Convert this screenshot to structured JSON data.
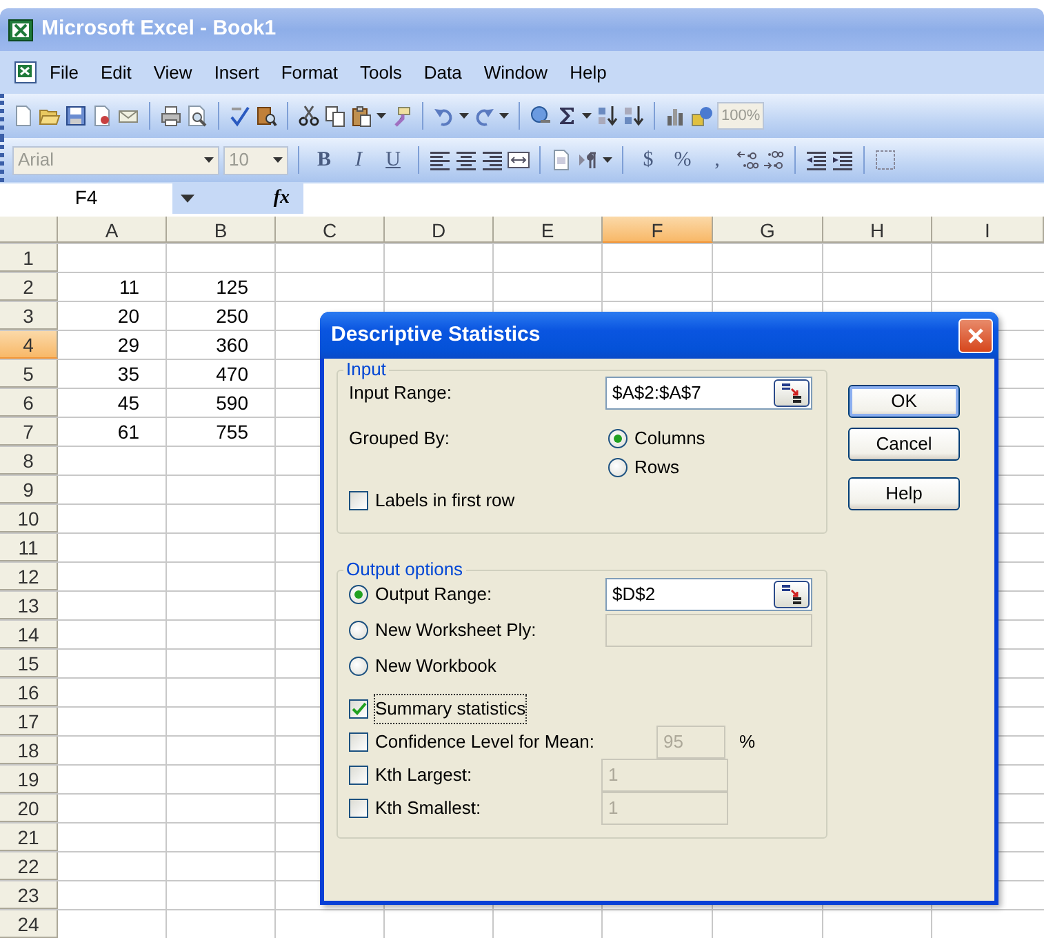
{
  "window": {
    "title": "Microsoft Excel - Book1"
  },
  "menu": [
    {
      "label": "File"
    },
    {
      "label": "Edit"
    },
    {
      "label": "View"
    },
    {
      "label": "Insert"
    },
    {
      "label": "Format"
    },
    {
      "label": "Tools"
    },
    {
      "label": "Data"
    },
    {
      "label": "Window"
    },
    {
      "label": "Help"
    }
  ],
  "standard_toolbar": {
    "zoom": "100%"
  },
  "formatting_toolbar": {
    "font": "Arial",
    "size": "10",
    "style_buttons": [
      "B",
      "I",
      "U"
    ],
    "number_buttons": [
      "$",
      "%",
      ","
    ]
  },
  "formula_bar": {
    "name_box": "F4",
    "function_label": "fx"
  },
  "sheet": {
    "columns": [
      {
        "label": "A",
        "selected": false
      },
      {
        "label": "B",
        "selected": false
      },
      {
        "label": "C",
        "selected": false
      },
      {
        "label": "D",
        "selected": false
      },
      {
        "label": "E",
        "selected": false
      },
      {
        "label": "F",
        "selected": true
      },
      {
        "label": "G",
        "selected": false
      },
      {
        "label": "H",
        "selected": false
      },
      {
        "label": "I",
        "selected": false
      }
    ],
    "rows": [
      {
        "label": "1",
        "selected": false
      },
      {
        "label": "2",
        "selected": false,
        "cells": [
          "11",
          "125"
        ]
      },
      {
        "label": "3",
        "selected": false,
        "cells": [
          "20",
          "250"
        ]
      },
      {
        "label": "4",
        "selected": true,
        "cells": [
          "29",
          "360"
        ]
      },
      {
        "label": "5",
        "selected": false,
        "cells": [
          "35",
          "470"
        ]
      },
      {
        "label": "6",
        "selected": false,
        "cells": [
          "45",
          "590"
        ]
      },
      {
        "label": "7",
        "selected": false,
        "cells": [
          "61",
          "755"
        ]
      },
      {
        "label": "8",
        "selected": false
      },
      {
        "label": "9",
        "selected": false
      },
      {
        "label": "10",
        "selected": false
      },
      {
        "label": "11",
        "selected": false
      },
      {
        "label": "12",
        "selected": false
      },
      {
        "label": "13",
        "selected": false
      },
      {
        "label": "14",
        "selected": false
      },
      {
        "label": "15",
        "selected": false
      },
      {
        "label": "16",
        "selected": false
      },
      {
        "label": "17",
        "selected": false
      },
      {
        "label": "18",
        "selected": false
      },
      {
        "label": "19",
        "selected": false
      },
      {
        "label": "20",
        "selected": false
      },
      {
        "label": "21",
        "selected": false
      },
      {
        "label": "22",
        "selected": false
      },
      {
        "label": "23",
        "selected": false
      },
      {
        "label": "24",
        "selected": false
      }
    ]
  },
  "dialog": {
    "title": "Descriptive Statistics",
    "input_group": {
      "legend": "Input",
      "input_range": {
        "label": "Input Range:",
        "value": "$A$2:$A$7"
      },
      "grouped_by": {
        "label": "Grouped By:",
        "options": [
          {
            "label": "Columns",
            "selected": true
          },
          {
            "label": "Rows",
            "selected": false
          }
        ]
      },
      "labels_in_first_row": {
        "label": "Labels in first row",
        "checked": false
      }
    },
    "output_group": {
      "legend": "Output options",
      "destinations": [
        {
          "label": "Output Range:",
          "selected": true,
          "field": {
            "value": "$D$2",
            "disabled": false
          }
        },
        {
          "label": "New Worksheet Ply:",
          "selected": false,
          "field": {
            "disabled": true
          }
        },
        {
          "label": "New Workbook",
          "selected": false
        }
      ],
      "options": [
        {
          "label": "Summary statistics",
          "checked": true,
          "focused": true
        },
        {
          "label": "Confidence Level for Mean:",
          "checked": false,
          "focused": false,
          "field": {
            "value": "95",
            "disabled": true
          },
          "unit": "%"
        },
        {
          "label": "Kth Largest:",
          "checked": false,
          "focused": false,
          "field": {
            "value": "1",
            "disabled": true
          }
        },
        {
          "label": "Kth Smallest:",
          "checked": false,
          "focused": false,
          "field": {
            "value": "1",
            "disabled": true
          }
        }
      ]
    },
    "buttons": [
      {
        "label": "OK",
        "default": true
      },
      {
        "label": "Cancel",
        "default": false
      },
      {
        "label": "Help",
        "default": false
      }
    ]
  }
}
